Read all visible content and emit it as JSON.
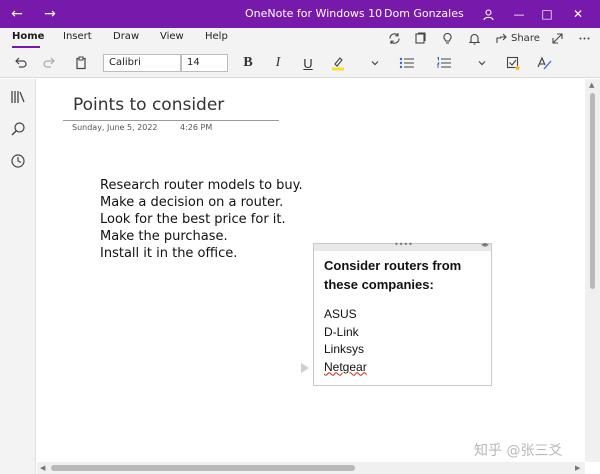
{
  "window": {
    "title": "OneNote for Windows 10",
    "user": "Dom Gonzales",
    "back_glyph": "←",
    "forward_glyph": "→",
    "minimize_glyph": "—",
    "maximize_glyph": "□",
    "close_glyph": "✕",
    "accent_color": "#7719aa"
  },
  "ribbon": {
    "tabs": [
      "Home",
      "Insert",
      "Draw",
      "View",
      "Help"
    ],
    "active_tab": "Home",
    "share_label": "Share"
  },
  "toolbar": {
    "font_name": "Calibri",
    "font_size": "14",
    "bold": "B",
    "italic": "I",
    "underline": "U"
  },
  "page": {
    "title": "Points to consider",
    "date": "Sunday, June 5, 2022",
    "time": "4:26 PM",
    "lines": [
      "Research router models to buy.",
      "Make a decision on a router.",
      "Look for the best price for it.",
      "Make the purchase.",
      "Install it in the office."
    ]
  },
  "note_box": {
    "heading_line1": "Consider routers from",
    "heading_line2": "these companies:",
    "items": [
      "ASUS",
      "D-Link",
      "Linksys",
      "Netgear"
    ]
  },
  "watermark": "知乎 @张三爻"
}
